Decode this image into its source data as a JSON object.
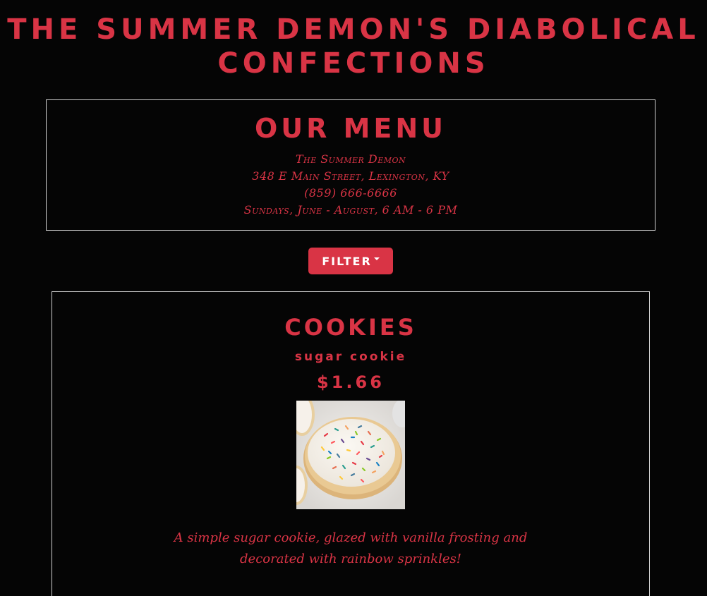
{
  "site": {
    "title_line1": "THE SUMMER DEMON'S DIABOLICAL",
    "title_line2": "CONFECTIONS"
  },
  "info": {
    "heading": "OUR MENU",
    "name": "The Summer Demon",
    "address": "348 E Main Street, Lexington, KY",
    "phone": "(859) 666-6666",
    "hours": "Sundays, June - August, 6 AM - 6 PM"
  },
  "filter": {
    "label": "FILTER",
    "icon": "caret-down-icon"
  },
  "category": {
    "heading": "COOKIES",
    "items": [
      {
        "name": "sugar cookie",
        "price": "$1.66",
        "image_icon": "sugar-cookie-photo",
        "description": "A simple sugar cookie, glazed with vanilla frosting and decorated with rainbow sprinkles!"
      }
    ]
  },
  "colors": {
    "background": "#050505",
    "accent": "#d93445",
    "border": "#cfcfcf",
    "button_text": "#ffffff"
  }
}
